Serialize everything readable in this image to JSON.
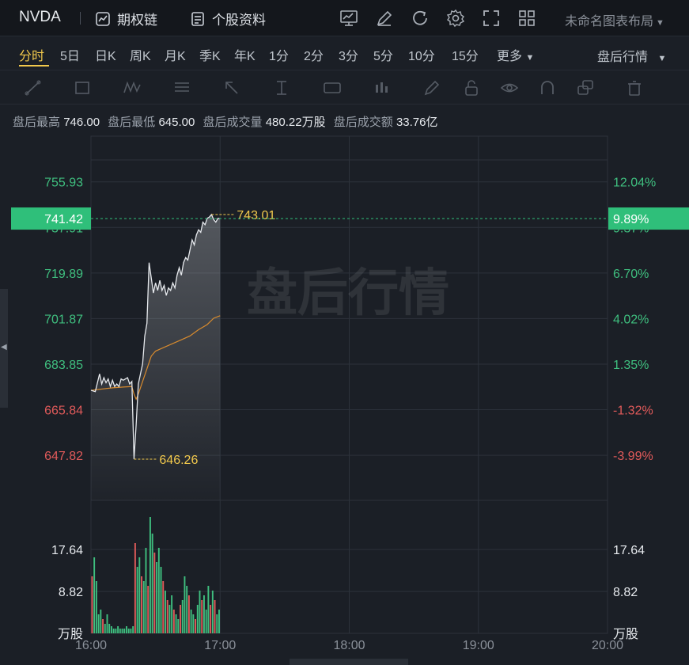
{
  "topbar": {
    "ticker": "NVDA",
    "options_chain": "期权链",
    "stock_profile": "个股资料",
    "layout_name": "未命名图表布局"
  },
  "periods": [
    "分时",
    "5日",
    "日K",
    "周K",
    "月K",
    "季K",
    "年K",
    "1分",
    "2分",
    "3分",
    "5分",
    "10分",
    "15分"
  ],
  "more_label": "更多",
  "market_mode": "盘后行情",
  "stats": [
    {
      "label": "盘后最高",
      "value": "746.00"
    },
    {
      "label": "盘后最低",
      "value": "645.00"
    },
    {
      "label": "盘后成交量",
      "value": "480.22万股"
    },
    {
      "label": "盘后成交额",
      "value": "33.76亿"
    }
  ],
  "chart_data": {
    "type": "line",
    "watermark": "盘后行情",
    "price_axis_labels": [
      {
        "price": 755.93,
        "label": "755.93",
        "color": "#3fbf7f"
      },
      {
        "price": 737.91,
        "label": "737.91",
        "color": "#3fbf7f"
      },
      {
        "price": 719.89,
        "label": "719.89",
        "color": "#3fbf7f"
      },
      {
        "price": 701.87,
        "label": "701.87",
        "color": "#3fbf7f"
      },
      {
        "price": 683.85,
        "label": "683.85",
        "color": "#3fbf7f"
      },
      {
        "price": 665.84,
        "label": "665.84",
        "color": "#e05a5a"
      },
      {
        "price": 647.82,
        "label": "647.82",
        "color": "#e05a5a"
      }
    ],
    "pct_axis_labels": [
      {
        "price": 755.93,
        "label": "12.04%",
        "color": "#3fbf7f"
      },
      {
        "price": 737.91,
        "label": "9.37%",
        "color": "#3fbf7f"
      },
      {
        "price": 719.89,
        "label": "6.70%",
        "color": "#3fbf7f"
      },
      {
        "price": 701.87,
        "label": "4.02%",
        "color": "#3fbf7f"
      },
      {
        "price": 683.85,
        "label": "1.35%",
        "color": "#3fbf7f"
      },
      {
        "price": 665.84,
        "label": "-1.32%",
        "color": "#e05a5a"
      },
      {
        "price": 647.82,
        "label": "-3.99%",
        "color": "#e05a5a"
      }
    ],
    "price_range": [
      630,
      774
    ],
    "current_price": {
      "price": 741.42,
      "label": "741.42",
      "pct": "9.89%"
    },
    "high_marker": {
      "price": 743.01,
      "label": "743.01",
      "minute": 56
    },
    "low_marker": {
      "price": 646.26,
      "label": "646.26",
      "minute": 20
    },
    "time_labels": [
      "16:00",
      "17:00",
      "18:00",
      "19:00",
      "20:00"
    ],
    "time_range_minutes": [
      0,
      240
    ],
    "price_line": [
      {
        "m": 0,
        "p": 673.5
      },
      {
        "m": 2,
        "p": 673.0
      },
      {
        "m": 4,
        "p": 680.0
      },
      {
        "m": 5,
        "p": 676.0
      },
      {
        "m": 6,
        "p": 678.5
      },
      {
        "m": 7,
        "p": 676.5
      },
      {
        "m": 8,
        "p": 678.0
      },
      {
        "m": 9,
        "p": 675.0
      },
      {
        "m": 10,
        "p": 677.5
      },
      {
        "m": 11,
        "p": 675.0
      },
      {
        "m": 12,
        "p": 676.0
      },
      {
        "m": 13,
        "p": 675.0
      },
      {
        "m": 14,
        "p": 678.0
      },
      {
        "m": 15,
        "p": 677.5
      },
      {
        "m": 16,
        "p": 678.0
      },
      {
        "m": 17,
        "p": 678.5
      },
      {
        "m": 18,
        "p": 676.0
      },
      {
        "m": 19,
        "p": 677.0
      },
      {
        "m": 20,
        "p": 646.3
      },
      {
        "m": 21,
        "p": 660.0
      },
      {
        "m": 22,
        "p": 676.0
      },
      {
        "m": 23,
        "p": 680.0
      },
      {
        "m": 24,
        "p": 684.0
      },
      {
        "m": 25,
        "p": 695.0
      },
      {
        "m": 26,
        "p": 700.0
      },
      {
        "m": 27,
        "p": 724.0
      },
      {
        "m": 28,
        "p": 718.0
      },
      {
        "m": 29,
        "p": 712.0
      },
      {
        "m": 30,
        "p": 716.0
      },
      {
        "m": 31,
        "p": 713.0
      },
      {
        "m": 32,
        "p": 717.0
      },
      {
        "m": 33,
        "p": 713.0
      },
      {
        "m": 34,
        "p": 715.0
      },
      {
        "m": 35,
        "p": 711.0
      },
      {
        "m": 36,
        "p": 714.0
      },
      {
        "m": 37,
        "p": 713.0
      },
      {
        "m": 38,
        "p": 716.0
      },
      {
        "m": 39,
        "p": 714.0
      },
      {
        "m": 40,
        "p": 719.0
      },
      {
        "m": 41,
        "p": 722.0
      },
      {
        "m": 42,
        "p": 719.0
      },
      {
        "m": 43,
        "p": 724.0
      },
      {
        "m": 44,
        "p": 726.0
      },
      {
        "m": 45,
        "p": 725.0
      },
      {
        "m": 46,
        "p": 729.0
      },
      {
        "m": 47,
        "p": 733.0
      },
      {
        "m": 48,
        "p": 731.0
      },
      {
        "m": 49,
        "p": 735.0
      },
      {
        "m": 50,
        "p": 737.0
      },
      {
        "m": 51,
        "p": 736.0
      },
      {
        "m": 52,
        "p": 740.0
      },
      {
        "m": 53,
        "p": 739.0
      },
      {
        "m": 54,
        "p": 741.5
      },
      {
        "m": 55,
        "p": 742.0
      },
      {
        "m": 56,
        "p": 743.0
      },
      {
        "m": 57,
        "p": 741.0
      },
      {
        "m": 58,
        "p": 740.0
      },
      {
        "m": 59,
        "p": 741.5
      },
      {
        "m": 60,
        "p": 741.4
      }
    ],
    "avg_line": [
      {
        "m": 0,
        "p": 673.5
      },
      {
        "m": 5,
        "p": 674.0
      },
      {
        "m": 10,
        "p": 674.5
      },
      {
        "m": 15,
        "p": 674.8
      },
      {
        "m": 19,
        "p": 675.0
      },
      {
        "m": 20,
        "p": 672.0
      },
      {
        "m": 21,
        "p": 670.0
      },
      {
        "m": 22,
        "p": 672.0
      },
      {
        "m": 24,
        "p": 677.0
      },
      {
        "m": 26,
        "p": 682.0
      },
      {
        "m": 28,
        "p": 687.0
      },
      {
        "m": 30,
        "p": 689.0
      },
      {
        "m": 34,
        "p": 690.5
      },
      {
        "m": 38,
        "p": 692.0
      },
      {
        "m": 42,
        "p": 693.5
      },
      {
        "m": 46,
        "p": 695.0
      },
      {
        "m": 50,
        "p": 697.5
      },
      {
        "m": 54,
        "p": 699.5
      },
      {
        "m": 57,
        "p": 702.0
      },
      {
        "m": 60,
        "p": 703.0
      }
    ],
    "volume": {
      "unit": "万股",
      "axis_labels": [
        {
          "value": 17.64,
          "label": "17.64"
        },
        {
          "value": 8.82,
          "label": "8.82"
        }
      ],
      "range": [
        0,
        26
      ],
      "bars": [
        {
          "m": 0,
          "v": 12,
          "c": "#e05a5a"
        },
        {
          "m": 1,
          "v": 16,
          "c": "#3fbf7f"
        },
        {
          "m": 2,
          "v": 11,
          "c": "#3fbf7f"
        },
        {
          "m": 3,
          "v": 4,
          "c": "#3fbf7f"
        },
        {
          "m": 4,
          "v": 5,
          "c": "#3fbf7f"
        },
        {
          "m": 5,
          "v": 3,
          "c": "#e05a5a"
        },
        {
          "m": 6,
          "v": 2,
          "c": "#3fbf7f"
        },
        {
          "m": 7,
          "v": 4,
          "c": "#3fbf7f"
        },
        {
          "m": 8,
          "v": 2,
          "c": "#3fbf7f"
        },
        {
          "m": 9,
          "v": 1.5,
          "c": "#3fbf7f"
        },
        {
          "m": 10,
          "v": 1,
          "c": "#3fbf7f"
        },
        {
          "m": 11,
          "v": 1,
          "c": "#3fbf7f"
        },
        {
          "m": 12,
          "v": 1.5,
          "c": "#3fbf7f"
        },
        {
          "m": 13,
          "v": 1,
          "c": "#3fbf7f"
        },
        {
          "m": 14,
          "v": 1,
          "c": "#3fbf7f"
        },
        {
          "m": 15,
          "v": 1,
          "c": "#3fbf7f"
        },
        {
          "m": 16,
          "v": 1.5,
          "c": "#3fbf7f"
        },
        {
          "m": 17,
          "v": 1,
          "c": "#3fbf7f"
        },
        {
          "m": 18,
          "v": 1,
          "c": "#3fbf7f"
        },
        {
          "m": 19,
          "v": 1.5,
          "c": "#3fbf7f"
        },
        {
          "m": 20,
          "v": 19,
          "c": "#e05a5a"
        },
        {
          "m": 21,
          "v": 14,
          "c": "#3fbf7f"
        },
        {
          "m": 22,
          "v": 16,
          "c": "#3fbf7f"
        },
        {
          "m": 23,
          "v": 12,
          "c": "#e05a5a"
        },
        {
          "m": 24,
          "v": 11,
          "c": "#3fbf7f"
        },
        {
          "m": 25,
          "v": 18,
          "c": "#3fbf7f"
        },
        {
          "m": 26,
          "v": 10,
          "c": "#e05a5a"
        },
        {
          "m": 27,
          "v": 24.5,
          "c": "#3fbf7f"
        },
        {
          "m": 28,
          "v": 21,
          "c": "#3fbf7f"
        },
        {
          "m": 29,
          "v": 17,
          "c": "#e05a5a"
        },
        {
          "m": 30,
          "v": 15,
          "c": "#3fbf7f"
        },
        {
          "m": 31,
          "v": 18,
          "c": "#3fbf7f"
        },
        {
          "m": 32,
          "v": 14,
          "c": "#3fbf7f"
        },
        {
          "m": 33,
          "v": 11,
          "c": "#e05a5a"
        },
        {
          "m": 34,
          "v": 9,
          "c": "#3fbf7f"
        },
        {
          "m": 35,
          "v": 7,
          "c": "#e05a5a"
        },
        {
          "m": 36,
          "v": 6,
          "c": "#3fbf7f"
        },
        {
          "m": 37,
          "v": 8,
          "c": "#3fbf7f"
        },
        {
          "m": 38,
          "v": 5,
          "c": "#e05a5a"
        },
        {
          "m": 39,
          "v": 4,
          "c": "#3fbf7f"
        },
        {
          "m": 40,
          "v": 3,
          "c": "#3fbf7f"
        },
        {
          "m": 41,
          "v": 6,
          "c": "#e05a5a"
        },
        {
          "m": 42,
          "v": 7,
          "c": "#3fbf7f"
        },
        {
          "m": 43,
          "v": 12,
          "c": "#3fbf7f"
        },
        {
          "m": 44,
          "v": 10,
          "c": "#3fbf7f"
        },
        {
          "m": 45,
          "v": 8,
          "c": "#e05a5a"
        },
        {
          "m": 46,
          "v": 5,
          "c": "#3fbf7f"
        },
        {
          "m": 47,
          "v": 4,
          "c": "#3fbf7f"
        },
        {
          "m": 48,
          "v": 3,
          "c": "#e05a5a"
        },
        {
          "m": 49,
          "v": 6,
          "c": "#3fbf7f"
        },
        {
          "m": 50,
          "v": 9,
          "c": "#3fbf7f"
        },
        {
          "m": 51,
          "v": 7,
          "c": "#e05a5a"
        },
        {
          "m": 52,
          "v": 8,
          "c": "#3fbf7f"
        },
        {
          "m": 53,
          "v": 5,
          "c": "#3fbf7f"
        },
        {
          "m": 54,
          "v": 10,
          "c": "#3fbf7f"
        },
        {
          "m": 55,
          "v": 6,
          "c": "#e05a5a"
        },
        {
          "m": 56,
          "v": 9,
          "c": "#3fbf7f"
        },
        {
          "m": 57,
          "v": 7,
          "c": "#e05a5a"
        },
        {
          "m": 58,
          "v": 4,
          "c": "#3fbf7f"
        },
        {
          "m": 59,
          "v": 5,
          "c": "#3fbf7f"
        }
      ]
    }
  }
}
